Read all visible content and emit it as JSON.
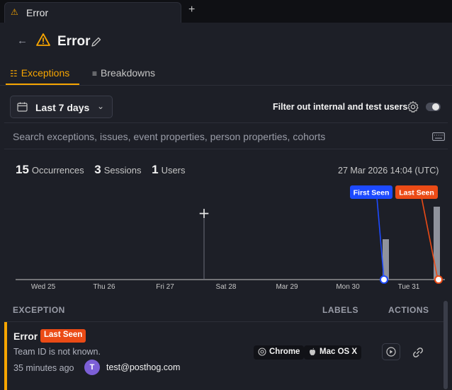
{
  "tab": {
    "title": "Error",
    "new_tab": "+"
  },
  "header": {
    "title": "Error"
  },
  "tabs": [
    {
      "label": "Exceptions"
    },
    {
      "label": "Breakdowns"
    }
  ],
  "toolbar": {
    "date_range": "Last 7 days",
    "filter_label": "Filter out internal and test users",
    "filter_enabled": false
  },
  "search": {
    "placeholder": "Search exceptions, issues, event properties, person properties, cohorts"
  },
  "stats": {
    "occurrences_value": "15",
    "occurrences_label": "Occurrences",
    "sessions_value": "3",
    "sessions_label": "Sessions",
    "users_value": "1",
    "users_label": "Users",
    "timestamp": "27 Mar 2026 14:04 (UTC)"
  },
  "chart_data": {
    "type": "bar",
    "categories": [
      "Wed 25",
      "Thu 26",
      "Fri 27",
      "Sat 28",
      "Mar 29",
      "Mon 30",
      "Tue 31"
    ],
    "markers": [
      {
        "label": "First Seen",
        "color": "#1d4aff"
      },
      {
        "label": "Last Seen",
        "color": "#eb4b16"
      }
    ],
    "notes": "Small bars appear near the end of Mon 30 and at Tue 31."
  },
  "table": {
    "headers": {
      "exception": "EXCEPTION",
      "labels": "LABELS",
      "actions": "ACTIONS"
    },
    "row": {
      "title": "Error",
      "badge": "Last Seen",
      "message": "Team ID is not known.",
      "time": "35 minutes ago",
      "avatar_initial": "T",
      "email": "test@posthog.com",
      "browser": "Chrome",
      "os": "Mac OS X"
    }
  },
  "colors": {
    "accent": "#f7a501",
    "first_seen": "#1d4aff",
    "last_seen": "#eb4b16",
    "background": "#1d1f27"
  }
}
